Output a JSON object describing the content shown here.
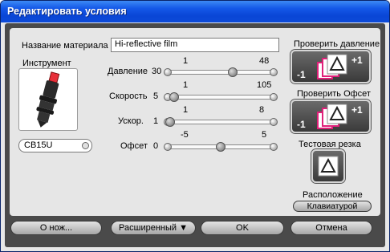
{
  "window": {
    "title": "Редактировать условия"
  },
  "material": {
    "label": "Название материала",
    "value": "Hi-reflective film"
  },
  "tool": {
    "label": "Инструмент",
    "selected": "CB15U"
  },
  "sliders": [
    {
      "label": "Давление",
      "value": "30",
      "min": "1",
      "max": "48",
      "fraction": 0.62
    },
    {
      "label": "Скорость",
      "value": "5",
      "min": "1",
      "max": "105",
      "fraction": 0.04
    },
    {
      "label": "Ускор.",
      "value": "1",
      "min": "1",
      "max": "8",
      "fraction": 0.0
    },
    {
      "label": "Офсет",
      "value": "0",
      "min": "-5",
      "max": "5",
      "fraction": 0.5
    }
  ],
  "pressure_test": {
    "label": "Проверить давление",
    "plus": "+1",
    "minus": "-1"
  },
  "offset_test": {
    "label": "Проверить Офсет",
    "plus": "+1",
    "minus": "-1"
  },
  "test_cut": {
    "label": "Тестовая резка"
  },
  "location": {
    "label": "Расположение",
    "button": "Клавиатурой"
  },
  "buttons": {
    "about_knife": "О нож...",
    "advanced": "Расширенный ▼",
    "ok": "OK",
    "cancel": "Отмена"
  },
  "colors": {
    "accent_magenta": "#e0207a",
    "tool_red": "#e8303a"
  }
}
